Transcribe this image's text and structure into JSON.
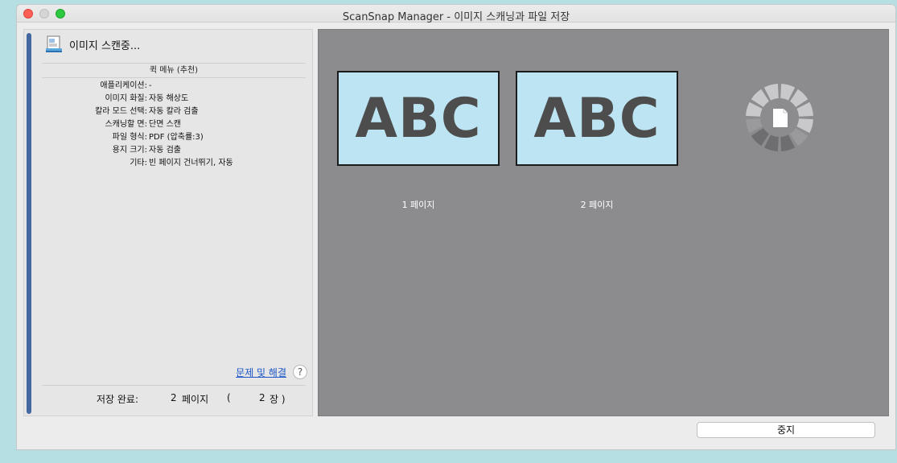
{
  "window": {
    "title": "ScanSnap Manager - 이미지 스캐닝과 파일 저장"
  },
  "left_panel": {
    "scanning_text": "이미지 스캔중...",
    "quick_menu_title": "퀵 메뉴 (추천)",
    "settings": [
      {
        "label": "애플리케이션:",
        "value": "-"
      },
      {
        "label": "이미지 화질:",
        "value": "자동 해상도"
      },
      {
        "label": "칼라 모드 선택:",
        "value": "자동 칼라 검출"
      },
      {
        "label": "스캐닝할 면:",
        "value": "단면 스캔"
      },
      {
        "label": "파일 형식:",
        "value": "PDF (압축률:3)"
      },
      {
        "label": "용지 크기:",
        "value": "자동 검출"
      },
      {
        "label": "기타:",
        "value": "빈 페이지 건너뛰기, 자동"
      }
    ],
    "help_link": "문제 및 해결",
    "help_icon_glyph": "?",
    "save_status": {
      "label": "저장 완료:",
      "pages_value": "2",
      "pages_unit": "페이지",
      "open_paren": "(",
      "sheets_value": "2",
      "sheets_unit": "장 )"
    }
  },
  "preview": {
    "pages": [
      {
        "thumbnail_text": "ABC",
        "label": "1 페이지"
      },
      {
        "thumbnail_text": "ABC",
        "label": "2 페이지"
      }
    ],
    "spinner_icon": "document-progress-spinner"
  },
  "buttons": {
    "stop_label": "중지"
  }
}
